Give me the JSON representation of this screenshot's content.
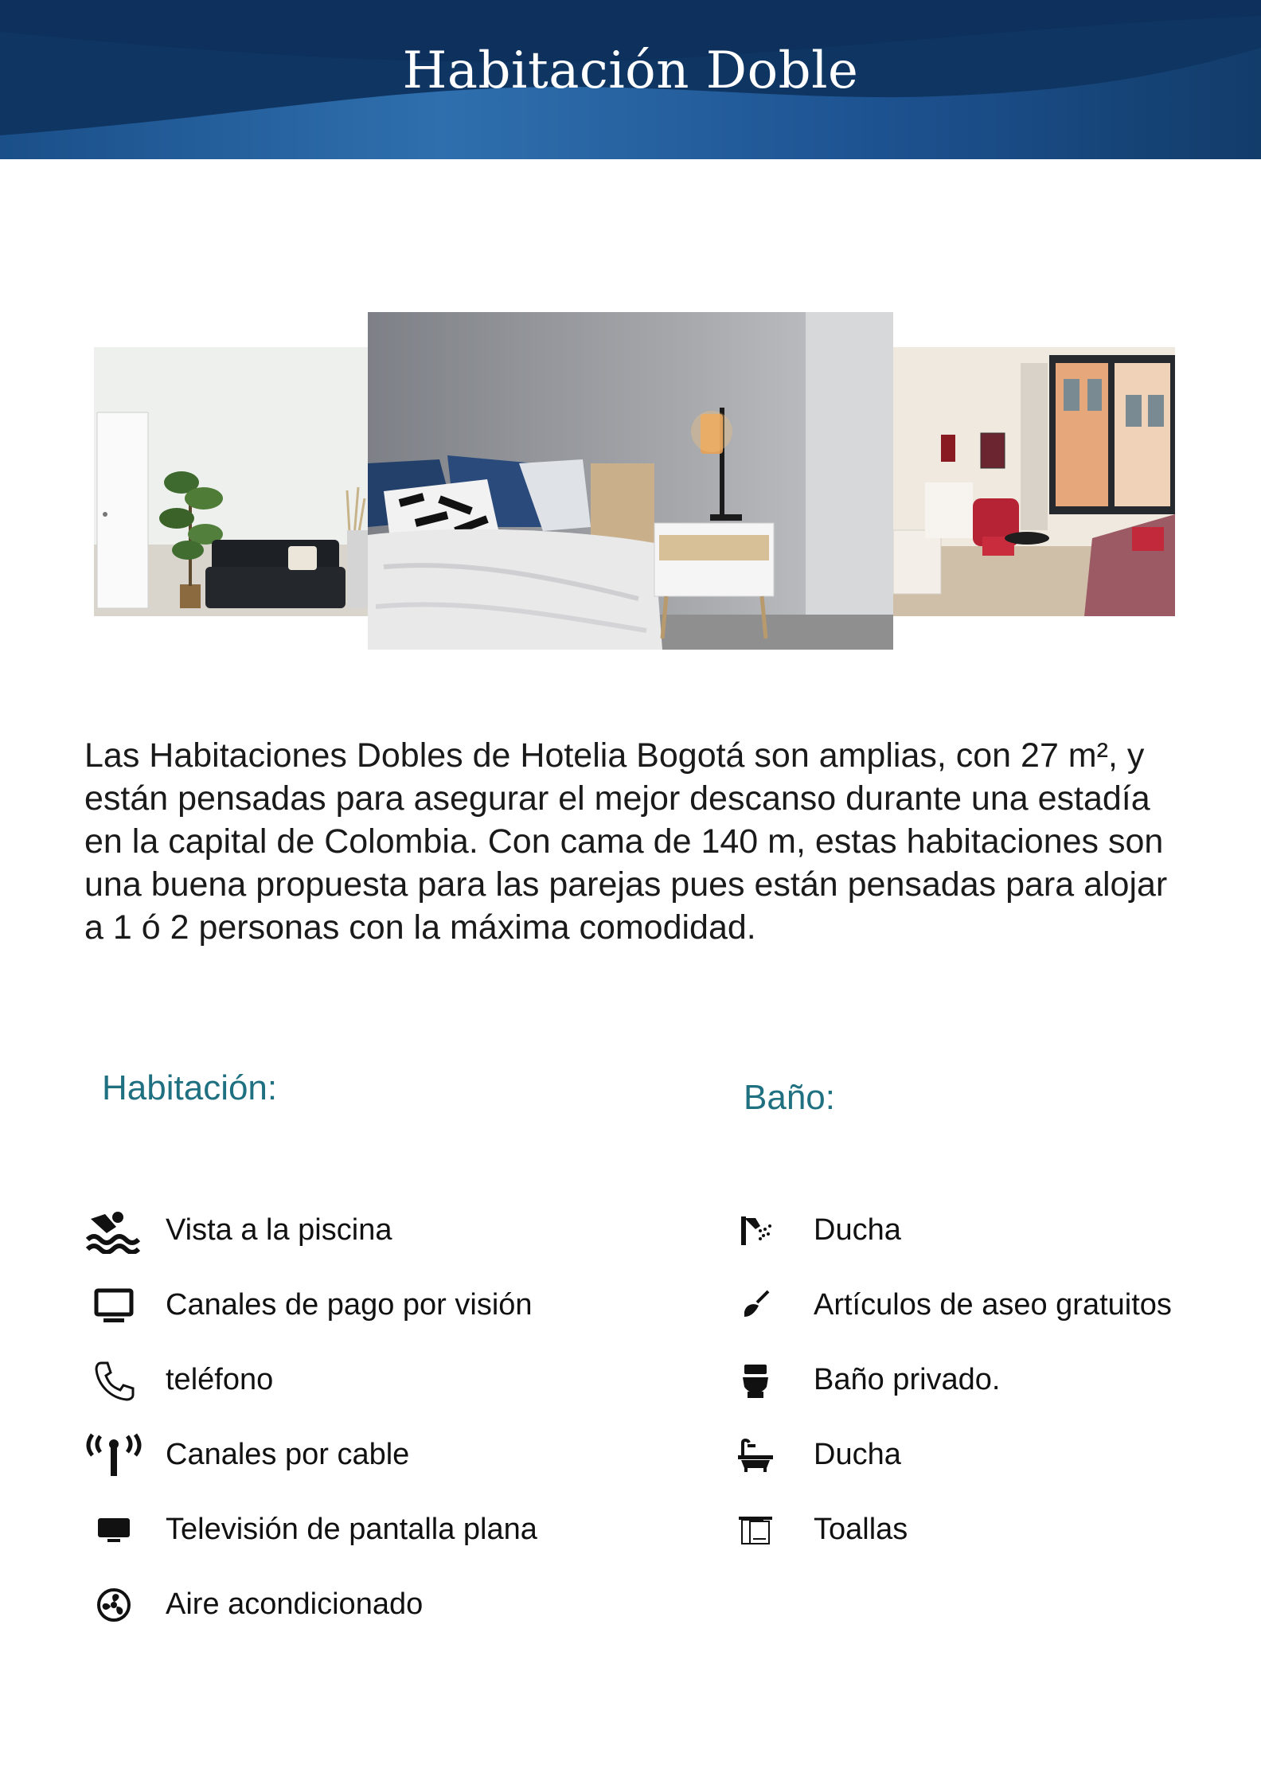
{
  "header": {
    "title": "Habitación Doble"
  },
  "colors": {
    "banner_dark": "#0f3562",
    "banner_light": "#2f6fae",
    "section_title": "#1f7080"
  },
  "gallery": [
    {
      "name": "living-room-photo",
      "description_icon": "photo"
    },
    {
      "name": "bedroom-photo",
      "description_icon": "photo"
    },
    {
      "name": "suite-photo",
      "description_icon": "photo"
    }
  ],
  "description": "Las Habitaciones Dobles de Hotelia Bogotá son amplias, con 27 m², y están pensadas para asegurar el mejor descanso durante una estadía en la capital de Colombia. Con cama de 140 m, estas habitaciones son una buena propuesta para las parejas pues están pensadas para alojar a 1 ó 2 personas con la máxima comodidad.",
  "room": {
    "title": "Habitación:",
    "items": [
      {
        "label": "Vista a la piscina",
        "icon": "swimming-icon"
      },
      {
        "label": "Canales de pago por visión",
        "icon": "monitor-icon"
      },
      {
        "label": "teléfono",
        "icon": "phone-icon"
      },
      {
        "label": "Canales por cable",
        "icon": "antenna-icon"
      },
      {
        "label": "Televisión de pantalla plana",
        "icon": "tv-icon"
      },
      {
        "label": "Aire acondicionado",
        "icon": "fan-icon"
      }
    ]
  },
  "bathroom": {
    "title": "Baño:",
    "items": [
      {
        "label": "Ducha",
        "icon": "shower-icon"
      },
      {
        "label": "Artículos de aseo gratuitos",
        "icon": "toiletries-icon"
      },
      {
        "label": "Baño privado.",
        "icon": "toilet-icon"
      },
      {
        "label": "Ducha",
        "icon": "bathtub-icon"
      },
      {
        "label": "Toallas",
        "icon": "towels-icon"
      }
    ]
  }
}
